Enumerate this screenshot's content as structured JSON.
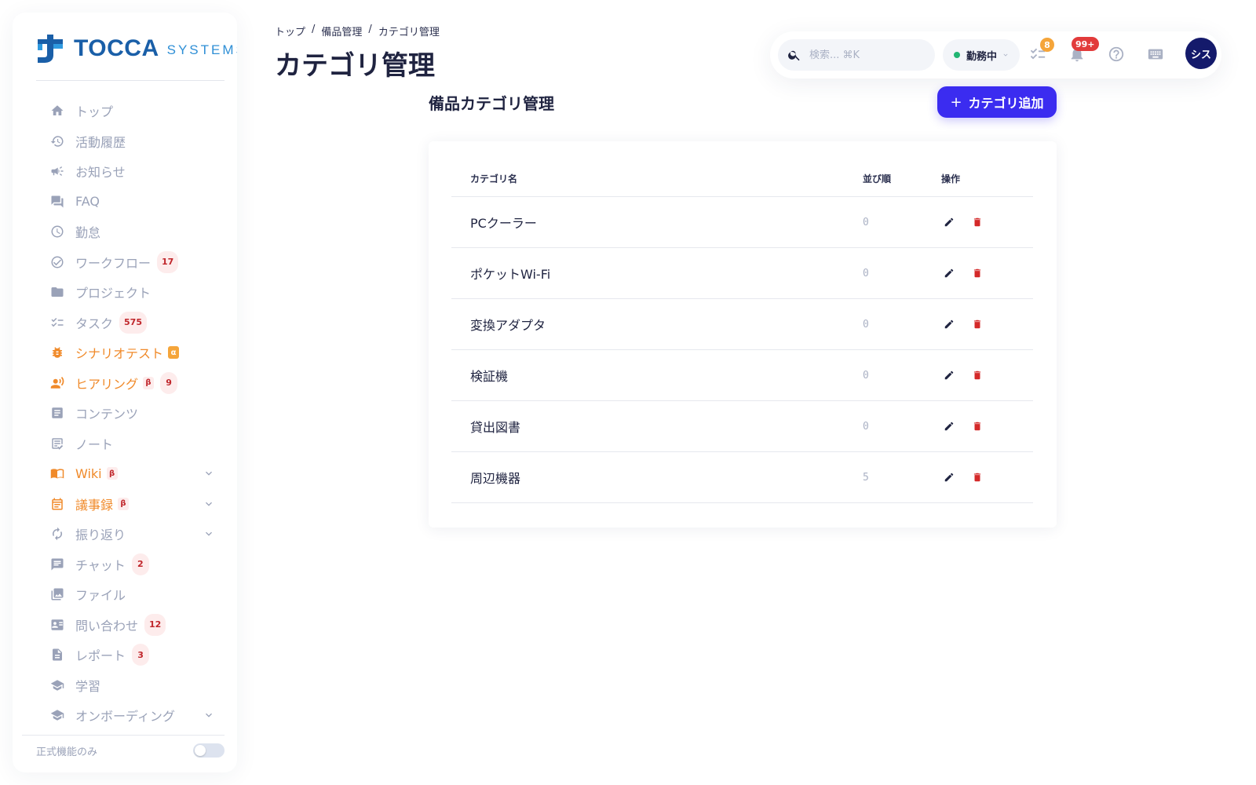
{
  "brand": {
    "name": "TOCCA",
    "sub": "SYSTEMS"
  },
  "sidebar": {
    "items": [
      {
        "label": "トップ",
        "icon": "home-icon"
      },
      {
        "label": "活動履歴",
        "icon": "history-icon"
      },
      {
        "label": "お知らせ",
        "icon": "megaphone-icon"
      },
      {
        "label": "FAQ",
        "icon": "forum-icon"
      },
      {
        "label": "勤怠",
        "icon": "clock-icon"
      },
      {
        "label": "ワークフロー",
        "icon": "check-circle-icon",
        "count": "17"
      },
      {
        "label": "プロジェクト",
        "icon": "folder-icon"
      },
      {
        "label": "タスク",
        "icon": "checklist-icon",
        "count": "575"
      },
      {
        "label": "シナリオテスト",
        "icon": "bug-icon",
        "tag": "α"
      },
      {
        "label": "ヒアリング",
        "icon": "voice-icon",
        "tag": "β",
        "count": "9"
      },
      {
        "label": "コンテンツ",
        "icon": "article-icon"
      },
      {
        "label": "ノート",
        "icon": "note-icon"
      },
      {
        "label": "Wiki",
        "icon": "book-icon",
        "tag": "β"
      },
      {
        "label": "議事録",
        "icon": "calendar-icon",
        "tag": "β"
      },
      {
        "label": "振り返り",
        "icon": "refresh-icon"
      },
      {
        "label": "チャット",
        "icon": "chat-icon",
        "count": "2"
      },
      {
        "label": "ファイル",
        "icon": "photo-library-icon"
      },
      {
        "label": "問い合わせ",
        "icon": "contact-card-icon",
        "count": "12"
      },
      {
        "label": "レポート",
        "icon": "document-icon",
        "count": "3"
      },
      {
        "label": "学習",
        "icon": "school-icon"
      },
      {
        "label": "オンボーディング",
        "icon": "school-icon"
      }
    ],
    "footer_label": "正式機能のみ"
  },
  "breadcrumb": [
    "トップ",
    "備品管理",
    "カテゴリ管理"
  ],
  "page_title": "カテゴリ管理",
  "topbar": {
    "search_placeholder": "検索... ⌘K",
    "status_label": "勤務中",
    "task_badge": "8",
    "notification_badge": "99+",
    "avatar_initials": "シス"
  },
  "section_title": "備品カテゴリ管理",
  "add_button_label": "カテゴリ追加",
  "table": {
    "headers": {
      "name": "カテゴリ名",
      "order": "並び順",
      "actions": "操作"
    },
    "rows": [
      {
        "name": "PCクーラー",
        "order": "0"
      },
      {
        "name": "ポケットWi-Fi",
        "order": "0"
      },
      {
        "name": "変換アダプタ",
        "order": "0"
      },
      {
        "name": "検証機",
        "order": "0"
      },
      {
        "name": "貸出図書",
        "order": "0"
      },
      {
        "name": "周辺機器",
        "order": "5"
      }
    ]
  },
  "colors": {
    "primary": "#3b2cf0",
    "accent_orange": "#f08a2a",
    "danger": "#d42929",
    "status_online": "#22b573",
    "avatar_bg": "#141a6b",
    "brand_blue": "#1a5fa8"
  }
}
